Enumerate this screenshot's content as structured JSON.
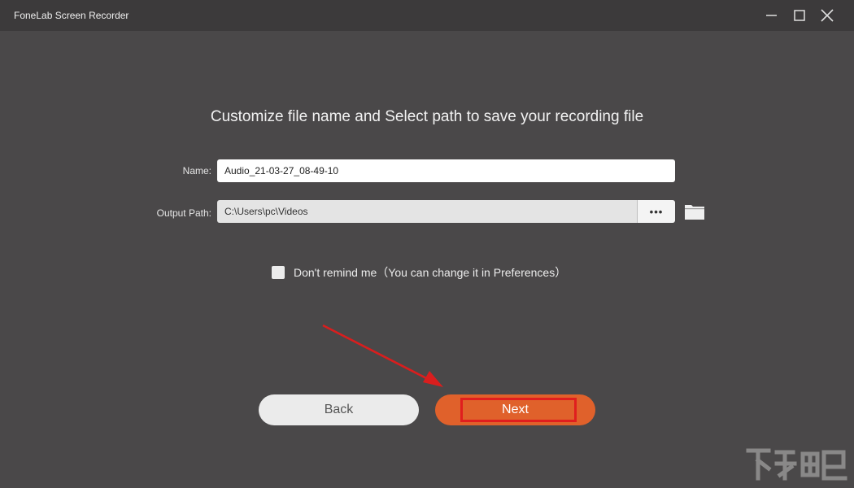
{
  "window": {
    "title": "FoneLab Screen Recorder",
    "controls": [
      "minimize-icon",
      "maximize-icon",
      "close-icon"
    ]
  },
  "main": {
    "heading": "Customize file name and Select path to save your recording file",
    "name_label": "Name:",
    "name_value": "Audio_21-03-27_08-49-10",
    "output_label": "Output Path:",
    "output_value": "C:\\Users\\pc\\Videos",
    "browse_label": "•••",
    "folder_icon": "folder-icon",
    "remind_text": "Don't remind me（You can change it in Preferences）",
    "remind_checked": false
  },
  "buttons": {
    "back_label": "Back",
    "next_label": "Next"
  },
  "colors": {
    "background": "#4a4849",
    "titlebar": "#3c3a3b",
    "accent": "#e0612b",
    "annotation": "#e01e1e"
  }
}
